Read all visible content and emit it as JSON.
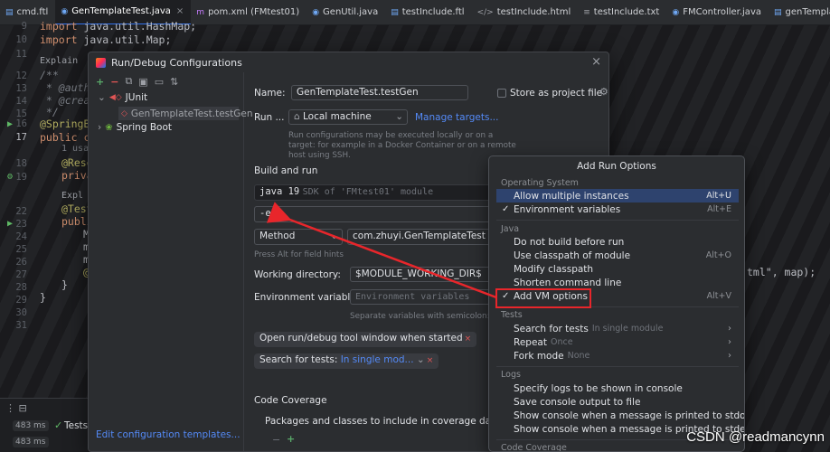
{
  "tabs": [
    {
      "label": "cmd.ftl",
      "icon": "ftl-file-icon"
    },
    {
      "label": "GenTemplateTest.java",
      "icon": "java-class-icon",
      "active": true
    },
    {
      "label": "pom.xml (FMtest01)",
      "icon": "maven-icon"
    },
    {
      "label": "GenUtil.java",
      "icon": "java-class-icon"
    },
    {
      "label": "testInclude.ftl",
      "icon": "ftl-file-icon"
    },
    {
      "label": "testInclude.html",
      "icon": "html-file-icon"
    },
    {
      "label": "testInclude.txt",
      "icon": "text-file-icon"
    },
    {
      "label": "FMController.java",
      "icon": "java-class-icon"
    },
    {
      "label": "genTemplate.ftl",
      "icon": "ftl-file-icon"
    }
  ],
  "editor": {
    "line_numbers": [
      "9",
      "10",
      "11",
      "12",
      "13",
      "14",
      "15",
      "16",
      "17",
      "",
      "18",
      "19",
      "",
      "22",
      "23",
      "24",
      "25",
      "26",
      "27",
      "28",
      "29",
      "30",
      "31"
    ],
    "code": [
      "import java.util.HashMap;",
      "import java.util.Map;",
      "Explain",
      "/**",
      " * @autho",
      " * @creat",
      " */",
      "@SpringBo",
      "public cl",
      "1 usag",
      "@Reso",
      "priva",
      "Expl",
      "@Test",
      "publi",
      "M",
      "m",
      "m",
      "@",
      "}",
      "}"
    ],
    "right_fragment": "tml\", map);"
  },
  "run_panel": {
    "time1": "483 ms",
    "time2": "483 ms",
    "tests_label": "Tests"
  },
  "dialog": {
    "title": "Run/Debug Configurations",
    "tree": {
      "junit": "JUnit",
      "selected": "GenTemplateTest.testGen",
      "spring": "Spring Boot"
    },
    "edit_templates": "Edit configuration templates...",
    "name_label": "Name:",
    "name_value": "GenTemplateTest.testGen",
    "store_label": "Store as project file",
    "run_on_label": "Run ...",
    "run_on_value": "Local machine",
    "manage_targets": "Manage targets...",
    "run_on_hint": "Run configurations may be executed locally or on a target: for example in a Docker Container or on a remote host using SSH.",
    "build_and_run": "Build and run",
    "java_version": "java 19",
    "sdk_text": "SDK of 'FMtest01' module",
    "vm_options": "-ea",
    "method_select": "Method",
    "class_value": "com.zhuyi.GenTemplateTest",
    "field_hints": "Press Alt for field hints",
    "workdir_label": "Working directory:",
    "workdir_value": "$MODULE_WORKING_DIR$",
    "env_label": "Environment variables:",
    "env_placeholder": "Environment variables",
    "env_hint": "Separate variables with semicolon: VAR",
    "chip1": "Open run/debug tool window when started",
    "chip2_prefix": "Search for tests: ",
    "chip2_value": "In single mod...",
    "code_coverage": "Code Coverage",
    "packages_label": "Packages and classes to include in coverage data"
  },
  "popup": {
    "title": "Add Run Options",
    "groups": {
      "os": "Operating System",
      "java": "Java",
      "tests": "Tests",
      "logs": "Logs",
      "coverage": "Code Coverage"
    },
    "os_options": [
      {
        "label": "Allow multiple instances",
        "shortcut": "Alt+U",
        "checked": false,
        "highlighted": true
      },
      {
        "label": "Environment variables",
        "shortcut": "Alt+E",
        "checked": true
      }
    ],
    "java_options": [
      {
        "label": "Do not build before run",
        "shortcut": ""
      },
      {
        "label": "Use classpath of module",
        "shortcut": "Alt+O"
      },
      {
        "label": "Modify classpath",
        "shortcut": ""
      },
      {
        "label": "Shorten command line",
        "shortcut": ""
      },
      {
        "label": "Add VM options",
        "shortcut": "Alt+V",
        "checked": true
      }
    ],
    "tests_options": [
      {
        "label": "Search for tests",
        "sub": "In single module"
      },
      {
        "label": "Repeat",
        "sub": "Once"
      },
      {
        "label": "Fork mode",
        "sub": "None"
      }
    ],
    "logs_options": [
      {
        "label": "Specify logs to be shown in console"
      },
      {
        "label": "Save console output to file"
      },
      {
        "label": "Show console when a message is printed to stdout"
      },
      {
        "label": "Show console when a message is printed to stderr"
      }
    ]
  },
  "watermark": "CSDN @readmancynn",
  "colors": {
    "accent": "#3574f0",
    "highlight": "#2e436e",
    "annotation_red": "#e8262b",
    "link": "#548af7"
  }
}
